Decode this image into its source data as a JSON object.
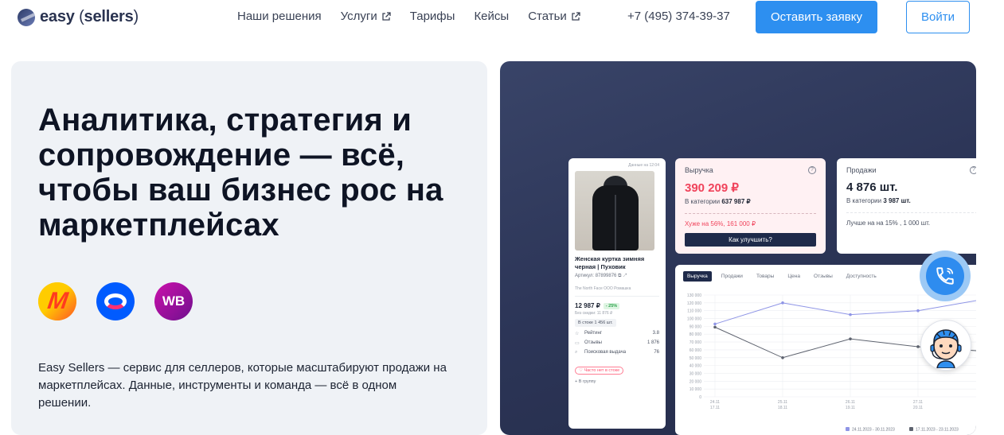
{
  "header": {
    "logo_text_1": "easy",
    "logo_text_2": "sellers",
    "nav": [
      {
        "label": "Наши решения",
        "external": false
      },
      {
        "label": "Услуги",
        "external": true
      },
      {
        "label": "Тарифы",
        "external": false
      },
      {
        "label": "Кейсы",
        "external": false
      },
      {
        "label": "Статьи",
        "external": true
      }
    ],
    "phone": "+7 (495) 374-39-37",
    "cta_label": "Оставить заявку",
    "login_label": "Войти"
  },
  "hero": {
    "title": "Аналитика, стратегия и сопровождение — всё, чтобы ваш бизнес рос на маркетплейсах",
    "marketplaces": [
      {
        "name": "yandex-market",
        "glyph": "M"
      },
      {
        "name": "ozon",
        "glyph": ""
      },
      {
        "name": "wildberries",
        "glyph": "WB"
      }
    ],
    "description": "Easy Sellers — сервис для селлеров, которые масштабируют продажи на маркетплейсах. Данные, инструменты и команда — всё в одном решении."
  },
  "dashboard": {
    "product": {
      "date": "Данные на 12:04",
      "name": "Женская куртка зимняя черная | Пуховик",
      "article": "Артикул: 87899876",
      "brand": "The North Face  ООО Ромашка",
      "price": "12 987 ₽",
      "discount": "- 25%",
      "no_discount": "Без скидки: 11 876 ₽",
      "stock": "В стоке 1 456 шт.",
      "metrics": [
        {
          "icon": "☆",
          "label": "Рейтинг",
          "value": "3.8"
        },
        {
          "icon": "▭",
          "label": "Отзывы",
          "value": "1 876"
        },
        {
          "icon": "⌕",
          "label": "Поисковая выдача",
          "value": "76"
        }
      ],
      "not_in_stock": "♡ Часто нет в стоке",
      "add_group": "+ В группу"
    },
    "revenue": {
      "label": "Выручка",
      "value": "390 209 ₽",
      "sub_prefix": "В категории ",
      "sub_value": "637 987 ₽",
      "note": "Хуже на 56%, 161 000 ₽",
      "button": "Как улучшить?"
    },
    "sales": {
      "label": "Продажи",
      "value": "4 876 шт.",
      "sub_prefix": "В категории ",
      "sub_value": "3 987 шт.",
      "note": "Лучше на на 15% , 1 000 шт."
    },
    "chart_tabs": [
      "Выручка",
      "Продажи",
      "Товары",
      "Цена",
      "Отзывы",
      "Доступность"
    ]
  },
  "chart_data": {
    "type": "line",
    "categories": [
      "24.11\n17.11",
      "25.11\n18.11",
      "26.11\n19.11",
      "27.11\n20.11",
      ""
    ],
    "ylim": [
      0,
      130000
    ],
    "yticks": [
      "0",
      "10 000",
      "20 000",
      "30 000",
      "40 000",
      "50 000",
      "60 000",
      "70 000",
      "80 000",
      "90 000",
      "100 000",
      "110 000",
      "120 000",
      "130 000"
    ],
    "series": [
      {
        "name": "24.11.2023 - 30.11.2023",
        "color": "#8f95e6",
        "values": [
          93000,
          120000,
          105000,
          110000,
          125000
        ]
      },
      {
        "name": "17.11.2023 - 23.11.2023",
        "color": "#5e636f",
        "values": [
          89000,
          50000,
          74000,
          64000,
          58000
        ]
      }
    ],
    "grid": true,
    "legend": "bottom-right"
  },
  "widgets": {
    "call_icon": "phone-icon",
    "bot_icon": "support-avatar-icon"
  }
}
